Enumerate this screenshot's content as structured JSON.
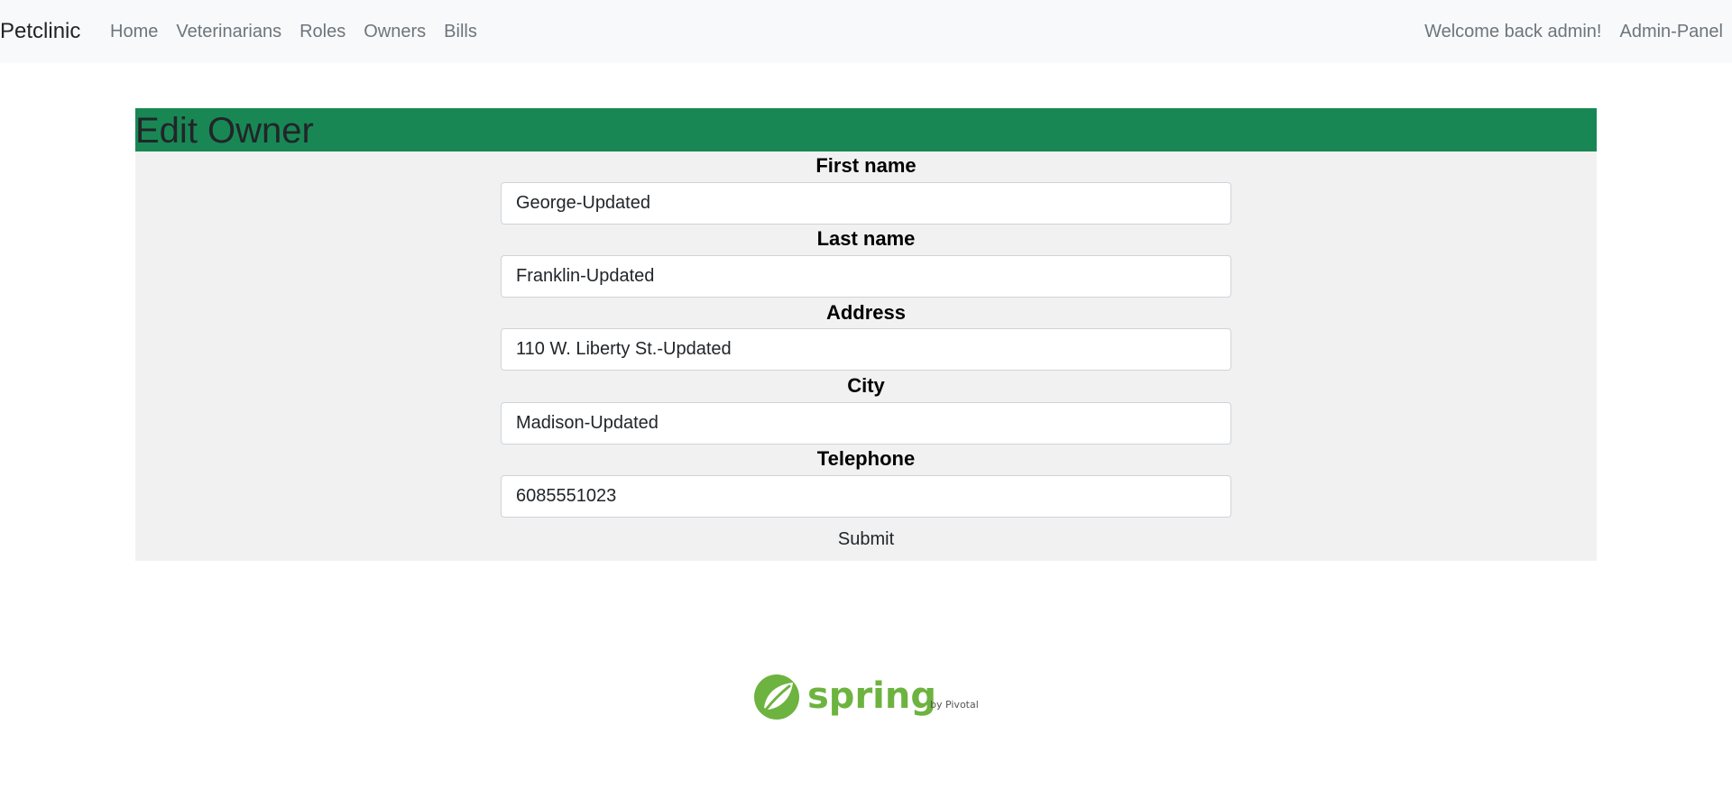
{
  "navbar": {
    "brand": "Petclinic",
    "left_links": [
      "Home",
      "Veterinarians",
      "Roles",
      "Owners",
      "Bills"
    ],
    "welcome": "Welcome back admin!",
    "admin_panel": "Admin-Panel"
  },
  "form": {
    "title": "Edit Owner",
    "fields": [
      {
        "label": "First name",
        "value": "George-Updated"
      },
      {
        "label": "Last name",
        "value": "Franklin-Updated"
      },
      {
        "label": "Address",
        "value": "110 W. Liberty St.-Updated"
      },
      {
        "label": "City",
        "value": "Madison-Updated"
      },
      {
        "label": "Telephone",
        "value": "6085551023"
      }
    ],
    "submit_label": "Submit"
  },
  "footer": {
    "logo_text": "spring",
    "logo_subtext": "by Pivotal.",
    "logo_color": "#6db33f"
  },
  "colors": {
    "header_green": "#198754",
    "card_bg": "#f1f1f1",
    "navbar_bg": "#f8f9fa"
  }
}
